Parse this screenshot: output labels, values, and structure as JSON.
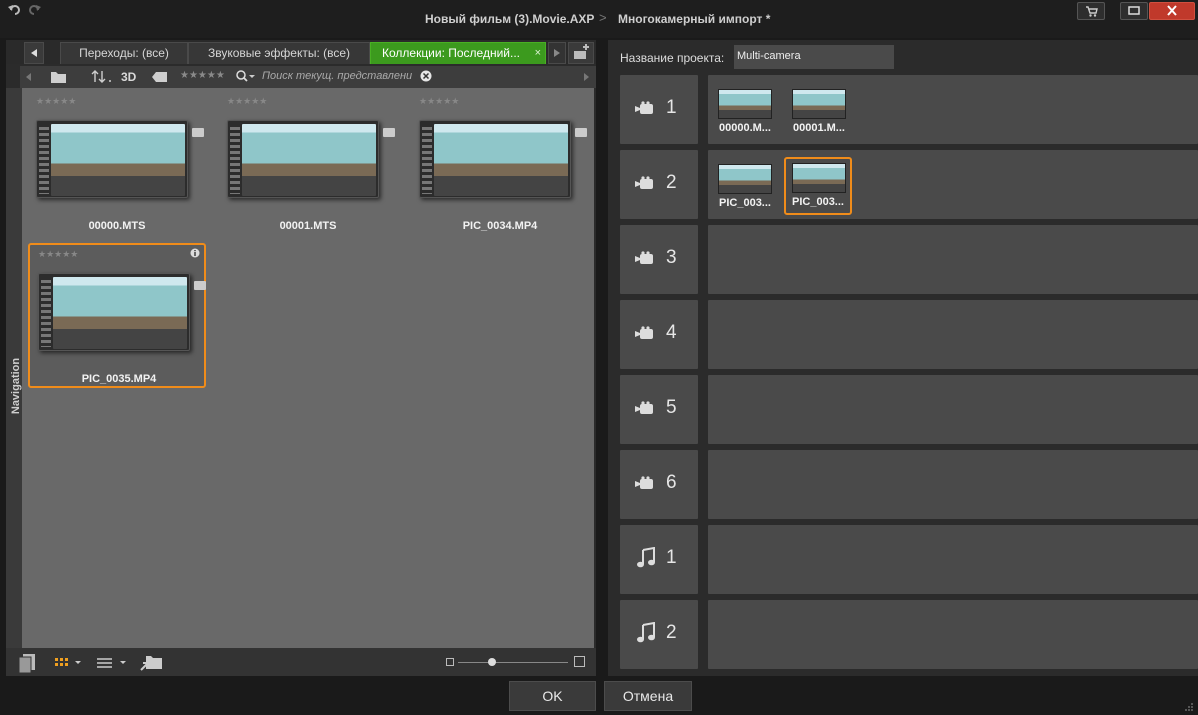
{
  "titlebar": {
    "project_path": "Новый фильм (3).Movie.AXP",
    "separator": ">",
    "current": "Многокамерный импорт *"
  },
  "tabs": [
    {
      "label": "Переходы: (все)",
      "active": false
    },
    {
      "label": "Звуковые эффекты: (все)",
      "active": false
    },
    {
      "label": "Коллекции: Последний...",
      "active": true
    }
  ],
  "toolbar": {
    "mode_3d": "3D",
    "rating": "★★★★★",
    "search_placeholder": "Поиск текущ. представлени"
  },
  "navigation_label": "Navigation",
  "library": {
    "clips": [
      {
        "name": "00000.MTS",
        "rating": "★★★★★",
        "selected": false
      },
      {
        "name": "00001.MTS",
        "rating": "★★★★★",
        "selected": false
      },
      {
        "name": "PIC_0034.MP4",
        "rating": "★★★★★",
        "selected": false
      },
      {
        "name": "PIC_0035.MP4",
        "rating": "★★★★★",
        "selected": true
      }
    ]
  },
  "project": {
    "name_label": "Название проекта:",
    "name_value": "Multi-camera"
  },
  "tracks": [
    {
      "type": "camera",
      "number": "1",
      "clips": [
        "00000.M...",
        "00001.M..."
      ]
    },
    {
      "type": "camera",
      "number": "2",
      "clips": [
        "PIC_003...",
        "PIC_003..."
      ],
      "selected_index": 1
    },
    {
      "type": "camera",
      "number": "3",
      "clips": []
    },
    {
      "type": "camera",
      "number": "4",
      "clips": []
    },
    {
      "type": "camera",
      "number": "5",
      "clips": []
    },
    {
      "type": "camera",
      "number": "6",
      "clips": []
    },
    {
      "type": "audio",
      "number": "1",
      "clips": []
    },
    {
      "type": "audio",
      "number": "2",
      "clips": []
    }
  ],
  "buttons": {
    "ok": "OK",
    "cancel": "Отмена"
  },
  "colors": {
    "accent_green": "#3c9a1e",
    "selection_orange": "#f08c1a",
    "close_red": "#c0392b"
  }
}
